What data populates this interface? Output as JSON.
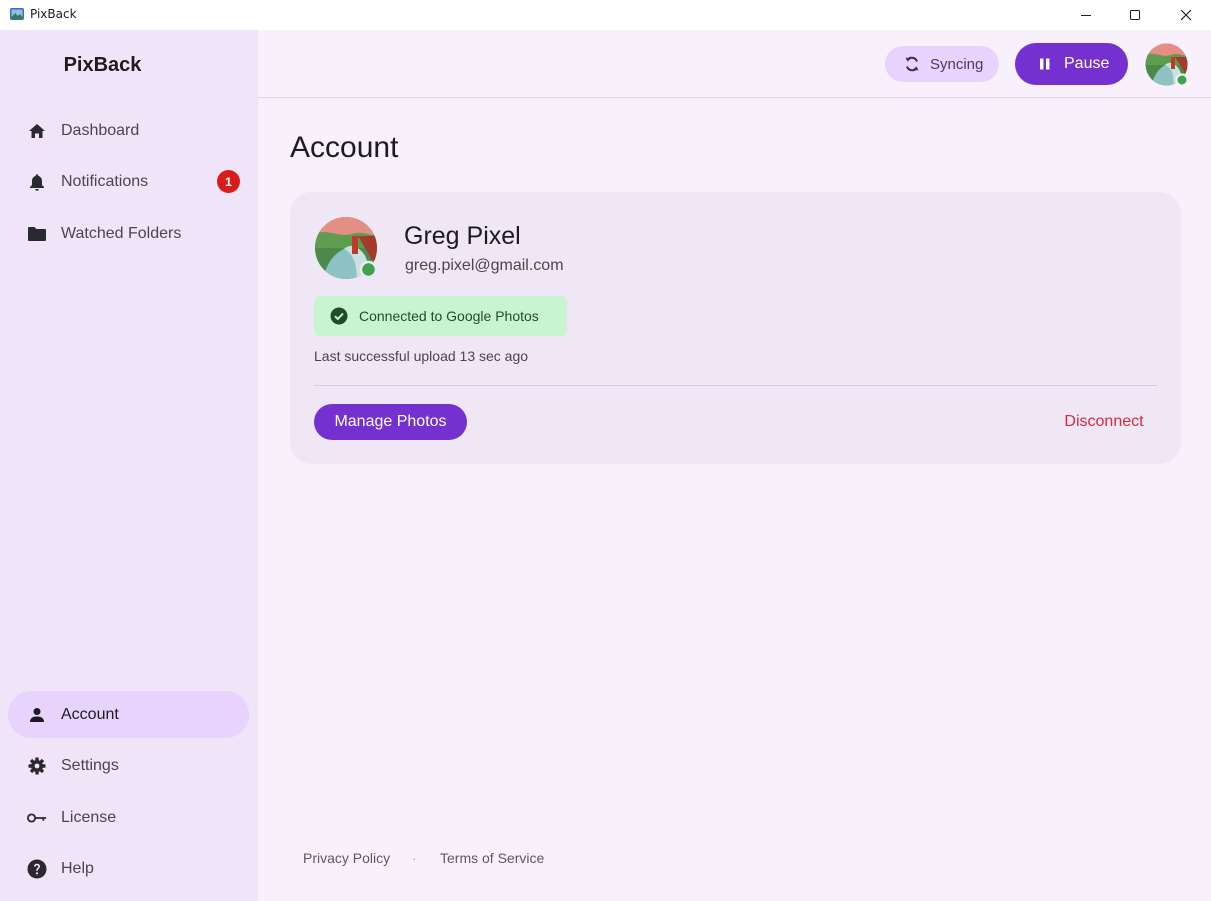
{
  "window": {
    "title": "PixBack",
    "controls": [
      "minimize-icon",
      "maximize-icon",
      "close-icon"
    ]
  },
  "sidebar": {
    "brand": "PixBack",
    "items": [
      {
        "label": "Dashboard",
        "icon": "home-icon"
      },
      {
        "label": "Notifications",
        "icon": "bell-icon",
        "badge": "1"
      },
      {
        "label": "Watched Folders",
        "icon": "folder-icon"
      },
      {
        "label": "Account",
        "icon": "person-icon",
        "active": true
      },
      {
        "label": "Settings",
        "icon": "gear-icon"
      },
      {
        "label": "License",
        "icon": "key-icon"
      },
      {
        "label": "Help",
        "icon": "help-icon"
      }
    ]
  },
  "topbar": {
    "sync_label": "Syncing",
    "pause_label": "Pause"
  },
  "main": {
    "title": "Account",
    "account": {
      "name": "Greg Pixel",
      "email": "greg.pixel@gmail.com",
      "status": "Connected to Google Photos",
      "last_upload": "Last successful upload 13 sec ago",
      "manage_label": "Manage Photos",
      "disconnect_label": "Disconnect"
    }
  },
  "footer": {
    "privacy": "Privacy Policy",
    "separator": "·",
    "terms": "Terms of Service"
  },
  "colors": {
    "accent": "#7530d0",
    "sidebar_bg": "#f0e5f8",
    "active_nav": "#e7d3fb",
    "success_bg": "#c8f5cf",
    "danger": "#d12b3d",
    "badge": "#d81b1b",
    "online_dot": "#3fa34d"
  }
}
